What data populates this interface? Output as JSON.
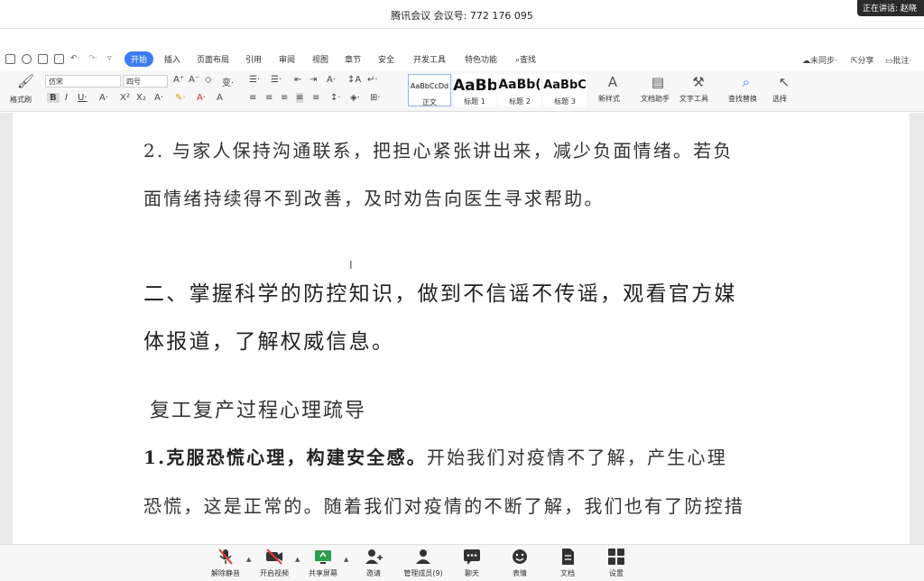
{
  "meeting": {
    "title": "腾讯会议 会议号: 772 176 095",
    "speaking": "正在讲话: 赵晓"
  },
  "menu": {
    "items": [
      "开始",
      "插入",
      "页面布局",
      "引用",
      "审阅",
      "视图",
      "章节",
      "安全",
      "开发工具",
      "特色功能"
    ],
    "search": "查找",
    "sync": "未同步",
    "share": "分享",
    "comment": "批注"
  },
  "ribbon": {
    "format_painter": "格式刷",
    "font_name": "仿宋",
    "font_size": "四号",
    "styles": [
      {
        "sample": "AaBbCcDd",
        "name": "正文"
      },
      {
        "sample": "AaBb",
        "name": "标题 1"
      },
      {
        "sample": "AaBb(",
        "name": "标题 2"
      },
      {
        "sample": "AaBbC",
        "name": "标题 3"
      }
    ],
    "new_style": "新样式",
    "doc_assistant": "文档助手",
    "text_tools": "文字工具",
    "find_replace": "查找替换",
    "select": "选择"
  },
  "document": {
    "para1_line1": "2. 与家人保持沟通联系，把担心紧张讲出来，减少负面情绪。若负",
    "para1_line2": "面情绪持续得不到改善，及时劝告向医生寻求帮助。",
    "heading_line1": "二、掌握科学的防控知识，做到不信谣不传谣，观看官方媒",
    "heading_line2": "体报道，了解权威信息。",
    "subheading": "复工复产过程心理疏导",
    "para2_bold": "1.克服恐慌心理，构建安全感。",
    "para2_rest": "开始我们对疫情不了解，产生心理",
    "para2_line2": "恐慌，这是正常的。随着我们对疫情的不断了解，我们也有了防控措"
  },
  "toolbar": {
    "items": [
      {
        "label": "解除静音",
        "icon": "mic-muted-icon"
      },
      {
        "label": "开启视频",
        "icon": "camera-off-icon"
      },
      {
        "label": "共享屏幕",
        "icon": "share-screen-icon"
      },
      {
        "label": "邀请",
        "icon": "invite-icon"
      },
      {
        "label": "管理成员(9)",
        "icon": "members-icon"
      },
      {
        "label": "聊天",
        "icon": "chat-icon"
      },
      {
        "label": "表情",
        "icon": "emoji-icon"
      },
      {
        "label": "文档",
        "icon": "document-icon"
      },
      {
        "label": "设置",
        "icon": "settings-icon"
      }
    ]
  },
  "colors": {
    "accent": "#3b7cf0",
    "muted_red": "#e53935",
    "share_green": "#2e9e4f"
  }
}
